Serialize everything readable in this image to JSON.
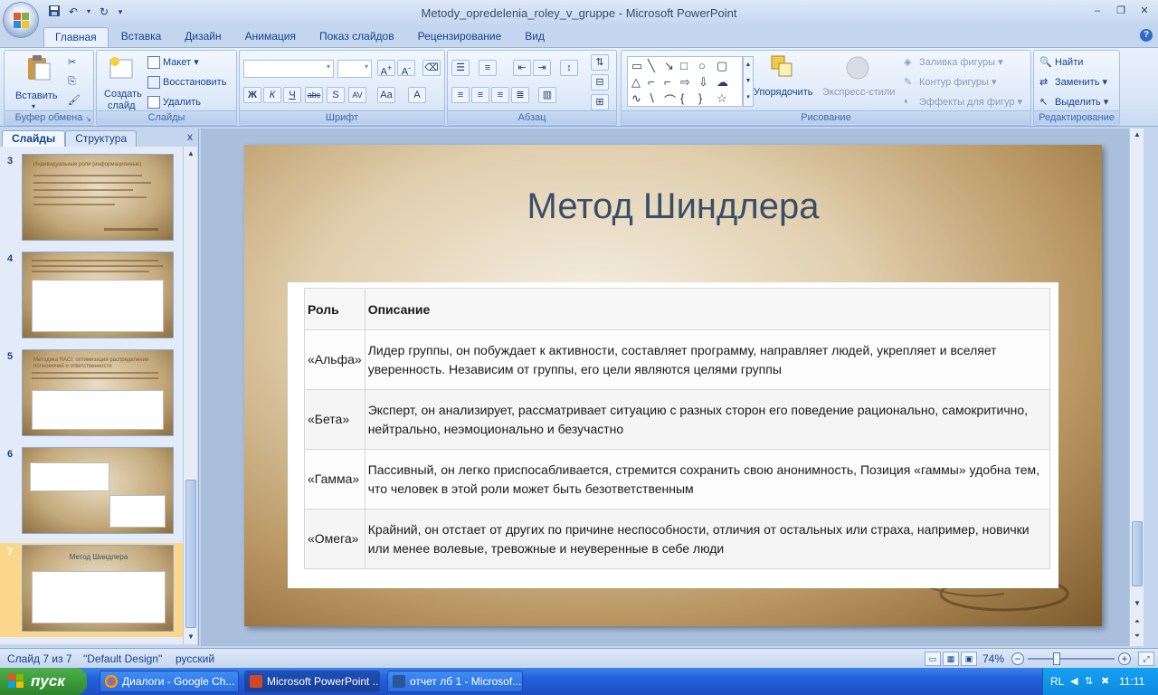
{
  "window": {
    "title": "Metody_opredelenia_roley_v_gruppe - Microsoft PowerPoint"
  },
  "ribbon_tabs": [
    "Главная",
    "Вставка",
    "Дизайн",
    "Анимация",
    "Показ слайдов",
    "Рецензирование",
    "Вид"
  ],
  "ribbon": {
    "clipboard": {
      "label": "Буфер обмена",
      "paste": "Вставить"
    },
    "slides": {
      "label": "Слайды",
      "new_slide_1": "Создать",
      "new_slide_2": "слайд",
      "layout": "Макет",
      "reset": "Восстановить",
      "delete": "Удалить"
    },
    "font": {
      "label": "Шрифт"
    },
    "paragraph": {
      "label": "Абзац"
    },
    "drawing": {
      "label": "Рисование",
      "arrange": "Упорядочить",
      "quick_styles": "Экспресс-стили",
      "fill": "Заливка фигуры",
      "outline": "Контур фигуры",
      "effects": "Эффекты для фигур"
    },
    "editing": {
      "label": "Редактирование",
      "find": "Найти",
      "replace": "Заменить",
      "select": "Выделить"
    }
  },
  "pane": {
    "tab_slides": "Слайды",
    "tab_outline": "Структура",
    "close": "x",
    "thumbnails": [
      {
        "number": "3",
        "title": "Индивидуальные роли (информационные)"
      },
      {
        "number": "4",
        "title": ""
      },
      {
        "number": "5",
        "title": "Методика RACI: оптимизация распределения полномочий и ответственности"
      },
      {
        "number": "6",
        "title": ""
      },
      {
        "number": "7",
        "title": "Метод Шиндлера",
        "selected": true
      }
    ]
  },
  "slide": {
    "title": "Метод Шиндлера",
    "table": {
      "headers": [
        "Роль",
        "Описание"
      ],
      "rows": [
        {
          "role": "«Альфа»",
          "description": "Лидер группы, он побуждает к активности, составляет программу, направляет людей, укрепляет и вселяет уверенность. Независим от группы, его цели являются целями группы"
        },
        {
          "role": "«Бета»",
          "description": "Эксперт, он анализирует, рассматривает ситуацию с разных сторон его поведение рационально, самокритично, нейтрально, неэмоционально и безучастно"
        },
        {
          "role": "«Гамма»",
          "description": "Пассивный, он легко приспосабливается, стремится сохранить свою анонимность, Позиция «гаммы» удобна тем, что человек в этой роли может быть безответственным"
        },
        {
          "role": "«Омега»",
          "description": "Крайний, он отстает от других по причине неспособности, отличия от остальных или страха, например, новички или менее волевые, тревожные и неуверенные в себе люди"
        }
      ]
    }
  },
  "status": {
    "slide_counter": "Слайд 7 из 7",
    "design": "\"Default Design\"",
    "language": "русский",
    "zoom": "74%"
  },
  "taskbar": {
    "start": "пуск",
    "tasks": [
      "Диалоги - Google Ch...",
      "Microsoft PowerPoint ...",
      "отчет лб 1 - Microsof..."
    ],
    "lang": "RL",
    "clock": "11:11"
  }
}
